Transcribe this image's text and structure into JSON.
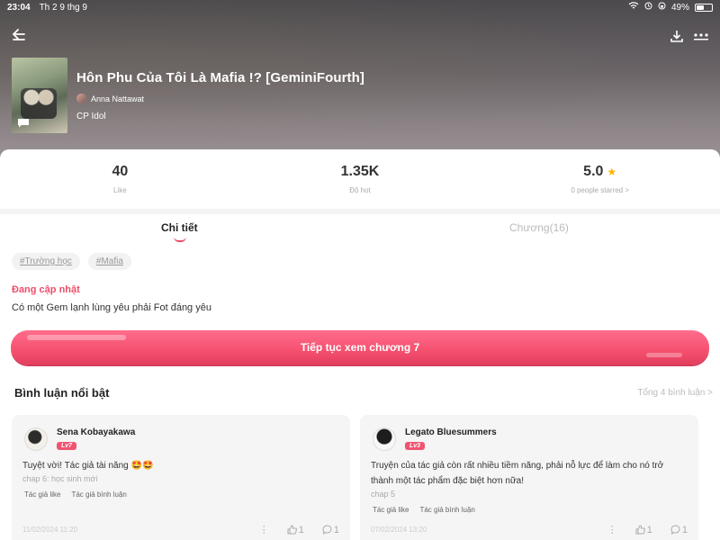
{
  "status": {
    "time": "23:04",
    "date": "Th 2 9 thg 9",
    "battery": "49%",
    "battery_level": 0.49
  },
  "story": {
    "title": "Hôn Phu Của Tôi Là Mafia !? [GeminiFourth]",
    "author": "Anna Nattawat",
    "category": "CP Idol"
  },
  "stats": [
    {
      "value": "40",
      "label": "Like"
    },
    {
      "value": "1.35K",
      "label": "Độ hot"
    },
    {
      "value": "5.0",
      "label": "0 people starred >"
    }
  ],
  "tabs": {
    "details": "Chi tiết",
    "chapters": "Chương(16)"
  },
  "tags": [
    "#Trường học",
    "#Mafia"
  ],
  "status_label": "Đang cập nhật",
  "description": "Có một Gem lạnh lùng yêu phải Fot đáng yêu",
  "cta": "Tiếp tục xem chương 7",
  "comments_section": {
    "title": "Bình luận nổi bật",
    "total": "Tổng 4 bình luận >"
  },
  "comments": [
    {
      "name": "Sena Kobayakawa",
      "level": "Lv7",
      "text": "Tuyệt vời! Tác giả tài năng 🤩🤩",
      "chapter": "chap 6: học sinh mới",
      "chips": [
        "Tác giả like",
        "Tác giả bình luận"
      ],
      "date": "11/02/2024 11:20",
      "likes": "1",
      "replies": "1"
    },
    {
      "name": "Legato Bluesummers",
      "level": "Lv3",
      "text": "Truyện của tác giả còn rất nhiều tiềm năng, phải nỗ lực để làm cho nó trở thành một tác phẩm đặc biệt hơn nữa!",
      "chapter": "chap 5",
      "chips": [
        "Tác giả like",
        "Tác giả bình luận"
      ],
      "date": "07/02/2024 13:20",
      "likes": "1",
      "replies": "1"
    }
  ]
}
